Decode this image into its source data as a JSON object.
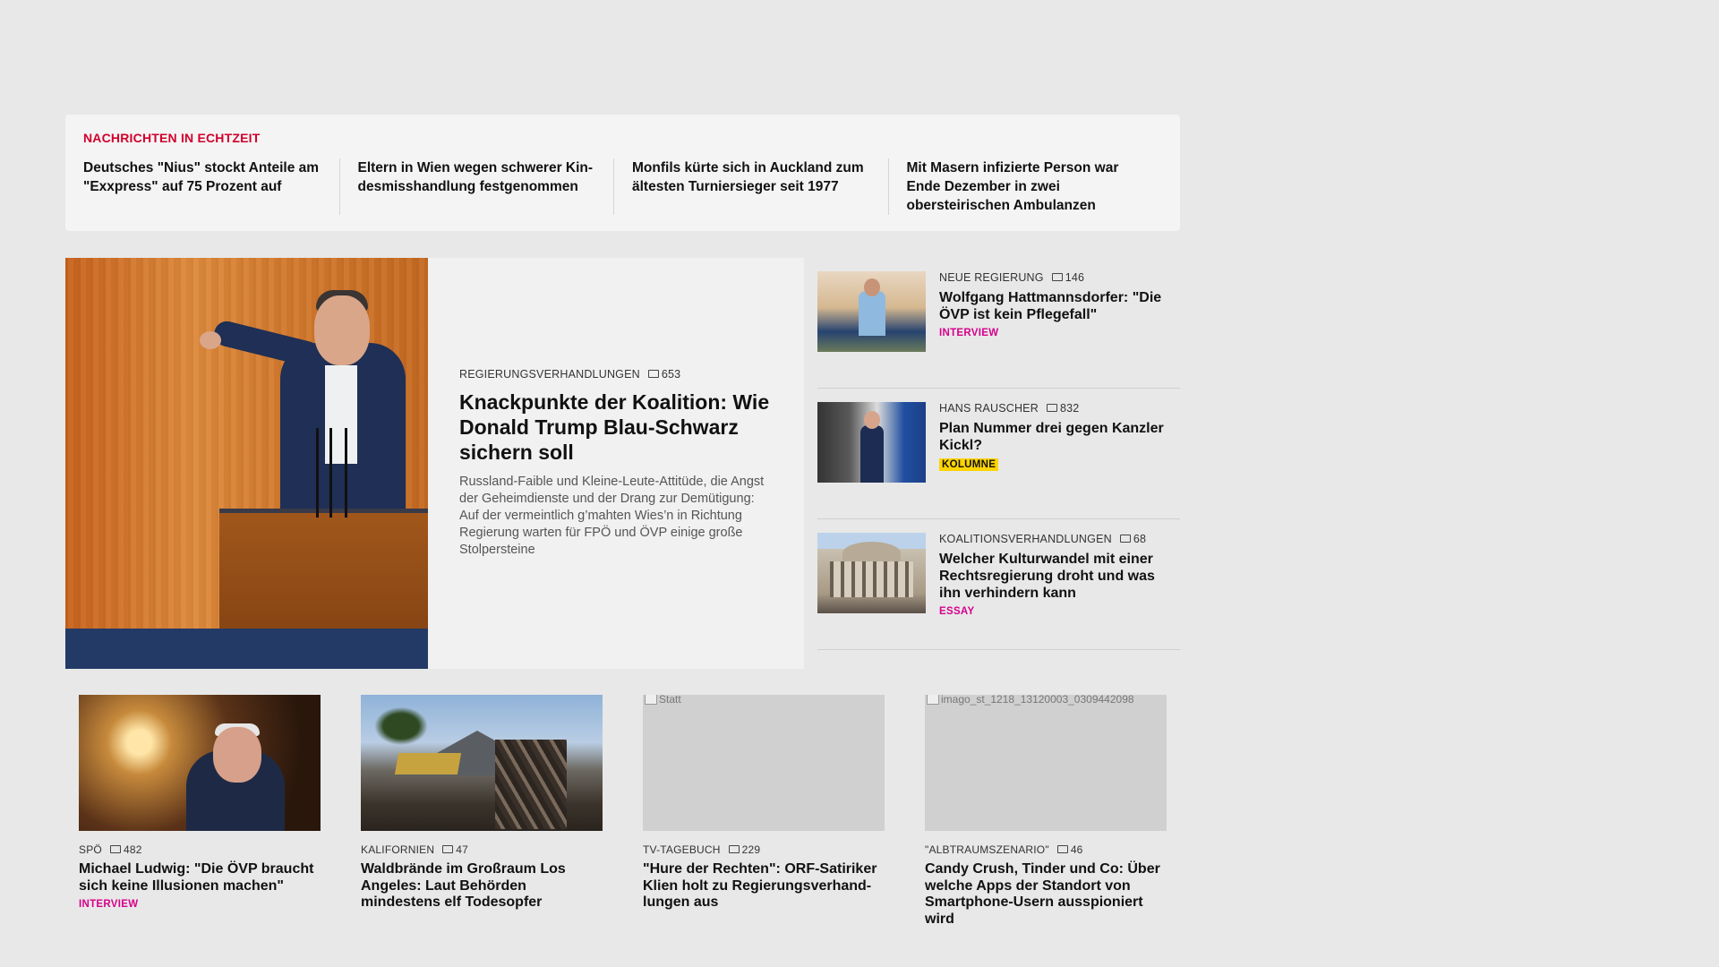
{
  "ticker": {
    "label": "NACHRICHTEN IN ECHTZEIT",
    "items": [
      "Deutsches \"Nius\" stockt Anteile am \"Exxpress\" auf 75 Prozent auf",
      "Eltern in Wien wegen schwerer Kin-desmisshandlung festgenommen",
      "Monfils kürte sich in Auckland zum ältesten Turniersieger seit 1977",
      "Mit Masern infizierte Person war Ende Dezember in zwei obersteirischen Ambulanzen"
    ]
  },
  "lead": {
    "kicker": "REGIERUNGSVERHANDLUNGEN",
    "comments": "653",
    "title": "Knackpunkte der Koalition: Wie Donald Trump Blau-Schwarz sichern soll",
    "teaser": "Russland-Faible und Kleine-Leute-Attitüde, die Angst der Geheimdienste und der Drang zur Demütigung: Auf der vermeintlich g’mahten Wies’n in Richtung Regierung warten für FPÖ und ÖVP einige große Stolpersteine"
  },
  "side": [
    {
      "kicker": "NEUE REGIERUNG",
      "comments": "146",
      "title": "Wolfgang Hattmannsdorfer: \"Die ÖVP ist kein Pflegefall\"",
      "tag": "INTERVIEW"
    },
    {
      "kicker": "HANS RAUSCHER",
      "comments": "832",
      "title": "Plan Nummer drei gegen Kanzler Kickl?",
      "tag": "KOLUMNE"
    },
    {
      "kicker": "KOALITIONSVERHANDLUNGEN",
      "comments": "68",
      "title": "Welcher Kulturwandel mit einer Rechtsregierung droht und was ihn verhindern kann",
      "tag": "ESSAY"
    }
  ],
  "cards": [
    {
      "kicker": "SPÖ",
      "comments": "482",
      "title": "Michael Ludwig: \"Die ÖVP braucht sich keine Illusionen machen\"",
      "tag": "INTERVIEW"
    },
    {
      "kicker": "KALIFORNIEN",
      "comments": "47",
      "title": "Waldbrände im Großraum Los Angeles: Laut Behörden mindestens elf Todesopfer"
    },
    {
      "kicker": "TV-TAGEBUCH",
      "comments": "229",
      "title": "\"Hure der Rechten\": ORF-Satiriker Klien holt zu Regierungsverhand-lungen aus",
      "img_alt": "Statt"
    },
    {
      "kicker": "\"ALBTRAUMSZENARIO\"",
      "comments": "46",
      "title": "Candy Crush, Tinder und Co: Über welche Apps der Standort von Smartphone-Usern ausspioniert wird",
      "img_alt": "imago_st_1218_13120003_0309442098"
    }
  ],
  "colors": {
    "ticker_label": "#d1002c",
    "tag_pink": "#d6008c",
    "tag_yellow": "#ffd400"
  }
}
